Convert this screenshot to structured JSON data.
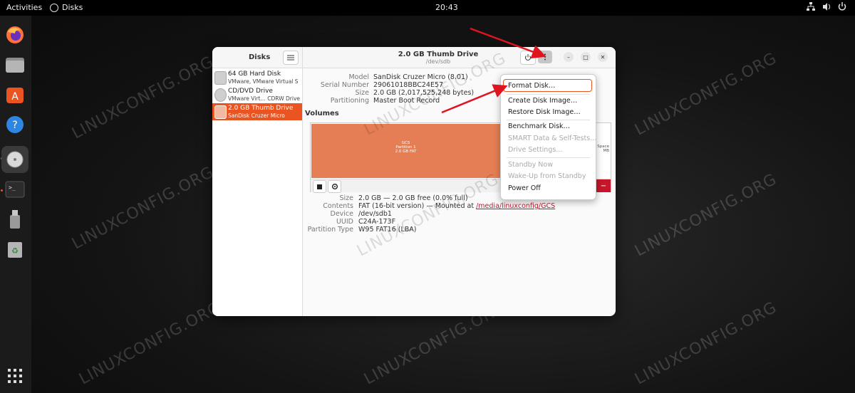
{
  "topbar": {
    "activities": "Activities",
    "app_name": "Disks",
    "clock": "20:43"
  },
  "dock": {
    "items": [
      "firefox-icon",
      "files-icon",
      "software-icon",
      "help-icon",
      "disks-icon",
      "terminal-icon",
      "usb-icon",
      "trash-icon"
    ]
  },
  "window": {
    "sidebar_title": "Disks",
    "disks": [
      {
        "name": "64 GB Hard Disk",
        "sub": "VMware, VMware Virtual S",
        "extra": ""
      },
      {
        "name": "CD/DVD Drive",
        "sub": "VMware Virt...",
        "extra": "CDRW Drive"
      },
      {
        "name": "2.0 GB Thumb Drive",
        "sub": "SanDisk Cruzer Micro",
        "extra": ""
      }
    ],
    "title": "2.0 GB Thumb Drive",
    "subtitle": "/dev/sdb",
    "drive_info": [
      {
        "key": "Model",
        "value": "SanDisk Cruzer Micro (8.01)"
      },
      {
        "key": "Serial Number",
        "value": "29061018BBC24E57"
      },
      {
        "key": "Size",
        "value": "2.0 GB (2,017,525,248 bytes)"
      },
      {
        "key": "Partitioning",
        "value": "Master Boot Record"
      }
    ],
    "volumes_label": "Volumes",
    "partition": {
      "line1": "GCS",
      "line2": "Partition 1",
      "line3": "2.0 GB FAT"
    },
    "free_space": {
      "line1": "Space",
      "line2": "MB"
    },
    "volume_info": [
      {
        "key": "Size",
        "value": "2.0 GB — 2.0 GB free (0.0% full)"
      },
      {
        "key": "Contents",
        "value": "FAT (16-bit version) — Mounted at ",
        "link": "/media/linuxconfig/GCS"
      },
      {
        "key": "Device",
        "value": "/dev/sdb1"
      },
      {
        "key": "UUID",
        "value": "C24A-173F"
      },
      {
        "key": "Partition Type",
        "value": "W95 FAT16 (LBA)"
      }
    ]
  },
  "menu": {
    "items": [
      {
        "label": "Format Disk…",
        "enabled": true
      },
      {
        "label": "Create Disk Image…",
        "enabled": true
      },
      {
        "label": "Restore Disk Image…",
        "enabled": true
      },
      {
        "label": "Benchmark Disk…",
        "enabled": true
      },
      {
        "label": "SMART Data & Self-Tests…",
        "enabled": false
      },
      {
        "label": "Drive Settings…",
        "enabled": false
      },
      {
        "label": "Standby Now",
        "enabled": false
      },
      {
        "label": "Wake-Up from Standby",
        "enabled": false
      },
      {
        "label": "Power Off",
        "enabled": true
      }
    ]
  },
  "watermark": "LINUXCONFIG.ORG",
  "colors": {
    "accent": "#e95420",
    "partition": "#e67e55",
    "danger": "#c7162b",
    "arrow": "#e0141e"
  }
}
